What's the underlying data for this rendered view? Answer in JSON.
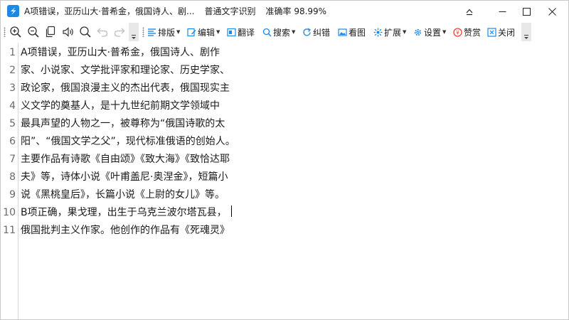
{
  "window": {
    "title": "A项错误，亚历山大·普希金，俄国诗人、剧...",
    "mode": "普通文字识别",
    "accuracy_label": "准确率",
    "accuracy_value": "98.99%",
    "controls": [
      "pin",
      "minimize",
      "maximize",
      "close"
    ]
  },
  "toolbar": {
    "icons": [
      "zoom-in-icon",
      "zoom-out-icon",
      "copy-icon",
      "speaker-icon",
      "search-icon",
      "undo-icon",
      "redo-icon"
    ],
    "layout_label": "排版",
    "edit_label": "编辑",
    "translate_label": "翻译",
    "search_label": "搜索",
    "correct_label": "纠错",
    "image_label": "看图",
    "extend_label": "扩展",
    "settings_label": "设置",
    "reward_label": "赞赏",
    "close_label": "关闭"
  },
  "editor": {
    "lines": [
      {
        "num": "1",
        "text": "A项错误，亚历山大·普希金，俄国诗人、剧作"
      },
      {
        "num": "2",
        "text": "家、小说家、文学批评家和理论家、历史学家、"
      },
      {
        "num": "3",
        "text": "政论家，俄国浪漫主义的杰出代表，俄国现实主"
      },
      {
        "num": "4",
        "text": "义文学的奠基人，是十九世纪前期文学领域中"
      },
      {
        "num": "5",
        "text": "最具声望的人物之一，被尊称为“俄国诗歌的太"
      },
      {
        "num": "6",
        "text": "阳”、“俄国文学之父”，现代标准俄语的创始人。"
      },
      {
        "num": "7",
        "text": "主要作品有诗歌《自由颂》《致大海》《致恰达耶"
      },
      {
        "num": "8",
        "text": "夫》等，诗体小说《叶甫盖尼·奥涅金》，短篇小"
      },
      {
        "num": "9",
        "text": "说《黑桃皇后》，长篇小说《上尉的女儿》等。"
      },
      {
        "num": "10",
        "text": "B项正确，果戈理，出生于乌克兰波尔塔瓦县，"
      },
      {
        "num": "11",
        "text": "俄国批判主义作家。他创作的作品有《死魂灵》"
      }
    ]
  },
  "colors": {
    "accent": "#1e88e5",
    "reward": "#e24a3b",
    "line_number": "#6b6b6b"
  }
}
